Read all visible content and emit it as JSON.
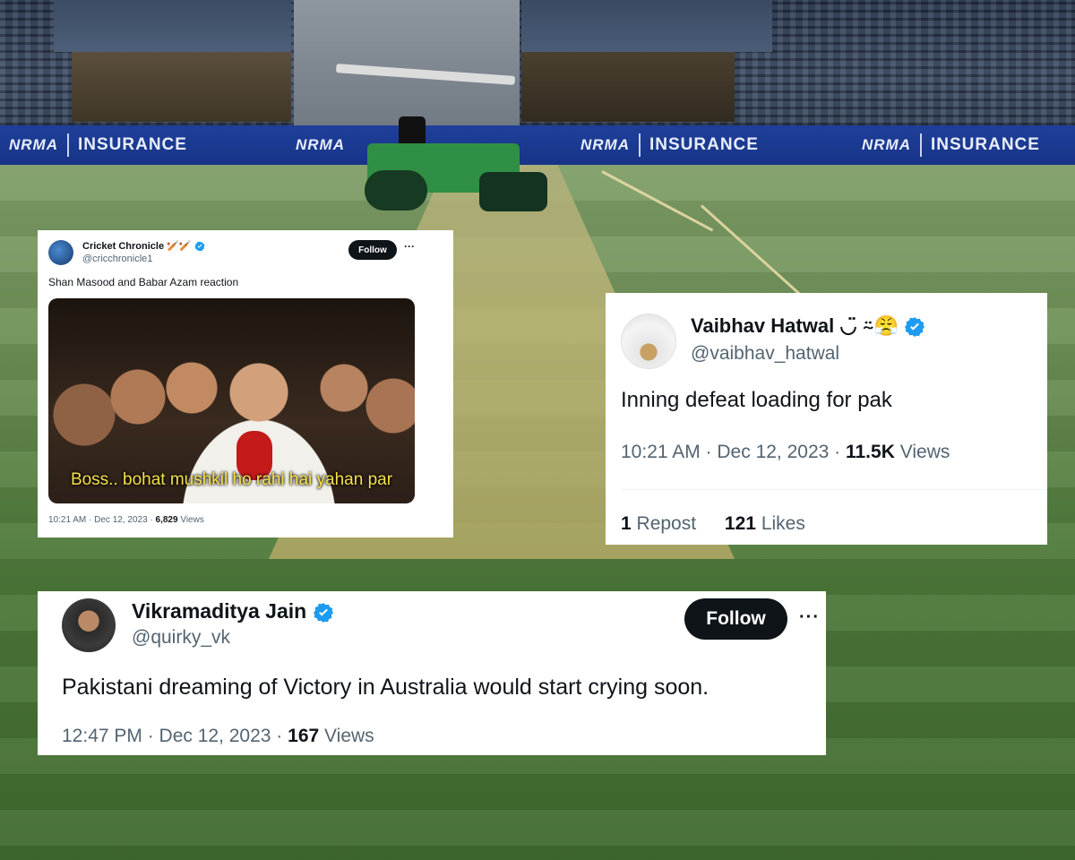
{
  "background": {
    "ads": [
      {
        "logo": "NRMA",
        "word": "INSURANCE"
      },
      {
        "logo": "NRMA",
        "word": ""
      },
      {
        "logo": "NRMA",
        "word": "INSURANCE"
      },
      {
        "logo": "NRMA",
        "word": "INSURANCE"
      }
    ],
    "colors": {
      "ad_band": "#1f3f9a",
      "field": "#4f7a3b",
      "pitch": "#c6b979"
    }
  },
  "tweets": [
    {
      "name": "Cricket Chronicle",
      "name_emoji": "🏏🏏",
      "handle": "@cricchronicle1",
      "verified": true,
      "follow_label": "Follow",
      "more_label": "···",
      "text": "Shan Masood and Babar Azam reaction",
      "media_caption": "Boss.. bohat mushkil ho rahi hai yahan par",
      "time": "10:21 AM · Dec 12, 2023 · ",
      "views_count": "6,829",
      "views_label": "Views"
    },
    {
      "name": "Vaibhav Hatwal",
      "name_emoji": "◡̈ ⍨😤",
      "handle": "@vaibhav_hatwal",
      "verified": true,
      "text": "Inning defeat loading for pak",
      "time": "10:21 AM · Dec 12, 2023 · ",
      "views_count": "11.5K",
      "views_label": "Views",
      "reposts_count": "1",
      "reposts_label": "Repost",
      "likes_count": "121",
      "likes_label": "Likes"
    },
    {
      "name": "Vikramaditya Jain",
      "handle": "@quirky_vk",
      "verified": true,
      "follow_label": "Follow",
      "more_label": "···",
      "text": "Pakistani dreaming of Victory in Australia would start crying soon.",
      "time": "12:47 PM · Dec 12, 2023 · ",
      "views_count": "167",
      "views_label": "Views"
    }
  ],
  "icons": {
    "verified": "verified-badge-icon",
    "more": "more-options-icon"
  },
  "colors": {
    "verified_blue": "#1d9bf0",
    "text": "#0f1419",
    "muted": "#536471",
    "follow_bg": "#0f1419"
  }
}
